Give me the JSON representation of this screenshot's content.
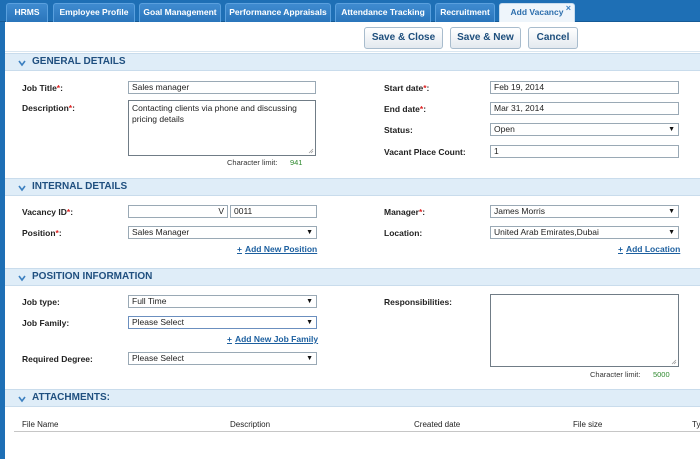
{
  "tabs": [
    {
      "label": "HRMS"
    },
    {
      "label": "Employee Profile"
    },
    {
      "label": "Goal Management"
    },
    {
      "label": "Performance Appraisals"
    },
    {
      "label": "Attendance Tracking"
    },
    {
      "label": "Recruitment"
    },
    {
      "label": "Add Vacancy",
      "close": "×"
    }
  ],
  "actions": {
    "save_close": "Save & Close",
    "save_new": "Save & New",
    "cancel": "Cancel"
  },
  "required_mark": "*",
  "general": {
    "title": "GENERAL DETAILS",
    "job_title_label": "Job Title",
    "job_title": "Sales manager",
    "description_label": "Description",
    "description": "Contacting clients via phone and discussing pricing details",
    "char_limit_label": "Character limit:",
    "char_limit": "941",
    "start_date_label": "Start date",
    "start_date": "Feb 19, 2014",
    "end_date_label": "End date",
    "end_date": "Mar 31, 2014",
    "status_label": "Status:",
    "status": "Open",
    "vacant_label": "Vacant Place Count:",
    "vacant": "1"
  },
  "internal": {
    "title": "INTERNAL DETAILS",
    "vacancy_id_label": "Vacancy ID",
    "vacancy_prefix": "V",
    "vacancy_id": "0011",
    "position_label": "Position",
    "position": "Sales Manager",
    "add_position": "Add New Position",
    "manager_label": "Manager",
    "manager": "James Morris",
    "location_label": "Location:",
    "location": "United Arab Emirates,Dubai",
    "add_location": "Add Location"
  },
  "position_info": {
    "title": "POSITION INFORMATION",
    "job_type_label": "Job type:",
    "job_type": "Full Time",
    "job_family_label": "Job Family:",
    "job_family": "Please Select",
    "add_job_family": "Add New Job Family",
    "degree_label": "Required Degree:",
    "degree": "Please Select",
    "resp_label": "Responsibilities:",
    "char_limit_label": "Character limit:",
    "char_limit": "5000"
  },
  "attachments": {
    "title": "ATTACHMENTS:",
    "columns": [
      "File Name",
      "Description",
      "Created date",
      "File size",
      "Ty"
    ]
  },
  "colors": {
    "brand": "#1e6fb5",
    "section_bg": "#dfedf8",
    "required": "#dd2222",
    "link": "#1c5f9f"
  }
}
